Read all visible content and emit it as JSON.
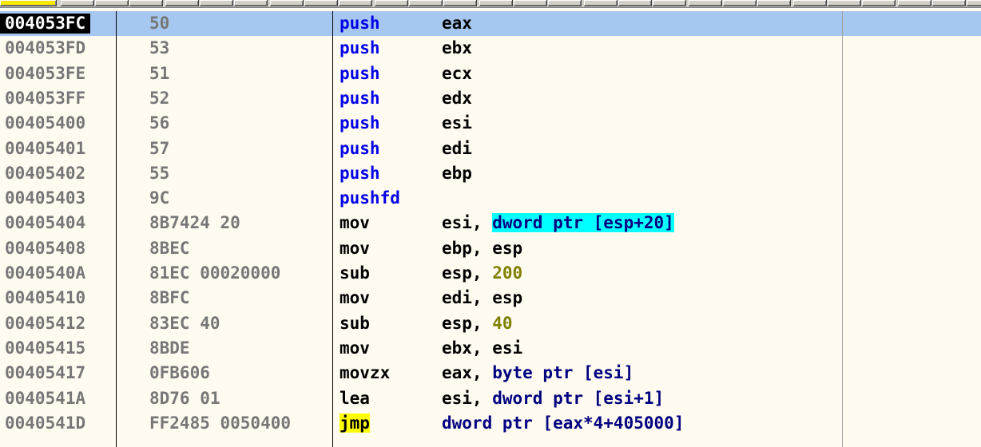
{
  "rows": [
    {
      "addr": "004053FC",
      "hex": "50",
      "mnemonic": "push",
      "operand_parts": [
        {
          "text": "eax",
          "style": "black"
        }
      ]
    },
    {
      "addr": "004053FD",
      "hex": "53",
      "mnemonic": "push",
      "operand_parts": [
        {
          "text": "ebx",
          "style": "black"
        }
      ]
    },
    {
      "addr": "004053FE",
      "hex": "51",
      "mnemonic": "push",
      "operand_parts": [
        {
          "text": "ecx",
          "style": "black"
        }
      ]
    },
    {
      "addr": "004053FF",
      "hex": "52",
      "mnemonic": "push",
      "operand_parts": [
        {
          "text": "edx",
          "style": "black"
        }
      ]
    },
    {
      "addr": "00405400",
      "hex": "56",
      "mnemonic": "push",
      "operand_parts": [
        {
          "text": "esi",
          "style": "black"
        }
      ]
    },
    {
      "addr": "00405401",
      "hex": "57",
      "mnemonic": "push",
      "operand_parts": [
        {
          "text": "edi",
          "style": "black"
        }
      ]
    },
    {
      "addr": "00405402",
      "hex": "55",
      "mnemonic": "push",
      "operand_parts": [
        {
          "text": "ebp",
          "style": "black"
        }
      ]
    },
    {
      "addr": "00405403",
      "hex": "9C",
      "mnemonic": "pushfd",
      "operand_parts": []
    },
    {
      "addr": "00405404",
      "hex": "8B7424 20",
      "mnemonic": "mov",
      "operand_parts": [
        {
          "text": "esi, ",
          "style": "black"
        },
        {
          "text": "dword ptr [esp+20]",
          "style": "cyan"
        }
      ]
    },
    {
      "addr": "00405408",
      "hex": "8BEC",
      "mnemonic": "mov",
      "operand_parts": [
        {
          "text": "ebp, esp",
          "style": "black"
        }
      ]
    },
    {
      "addr": "0040540A",
      "hex": "81EC 00020000",
      "mnemonic": "sub",
      "operand_parts": [
        {
          "text": "esp, ",
          "style": "black"
        },
        {
          "text": "200",
          "style": "olive"
        }
      ]
    },
    {
      "addr": "00405410",
      "hex": "8BFC",
      "mnemonic": "mov",
      "operand_parts": [
        {
          "text": "edi, esp",
          "style": "black"
        }
      ]
    },
    {
      "addr": "00405412",
      "hex": "83EC 40",
      "mnemonic": "sub",
      "operand_parts": [
        {
          "text": "esp, ",
          "style": "black"
        },
        {
          "text": "40",
          "style": "olive"
        }
      ]
    },
    {
      "addr": "00405415",
      "hex": "8BDE",
      "mnemonic": "mov",
      "operand_parts": [
        {
          "text": "ebx, esi",
          "style": "black"
        }
      ]
    },
    {
      "addr": "00405417",
      "hex": "0FB606",
      "mnemonic": "movzx",
      "operand_parts": [
        {
          "text": "eax, ",
          "style": "black"
        },
        {
          "text": "byte ptr [esi]",
          "style": "navy"
        }
      ]
    },
    {
      "addr": "0040541A",
      "hex": "8D76 01",
      "mnemonic": "lea",
      "operand_parts": [
        {
          "text": "esi, ",
          "style": "black"
        },
        {
          "text": "dword ptr [esi+1]",
          "style": "navy"
        }
      ]
    },
    {
      "addr": "0040541D",
      "hex": "FF2485 0050400",
      "mnemonic": "jmp",
      "operand_parts": [
        {
          "text": "dword ptr [eax*4+405000]",
          "style": "navy"
        }
      ]
    }
  ],
  "selected_index": 0,
  "colors": {
    "background": "#FFFBF0",
    "selected_row": "#A6C8F0",
    "push_mnemonic": "#0000E8",
    "memory_operand": "#000080",
    "immediate": "#808000",
    "highlight_operand": "#00FFFF",
    "jmp_highlight": "#FFFF00"
  }
}
